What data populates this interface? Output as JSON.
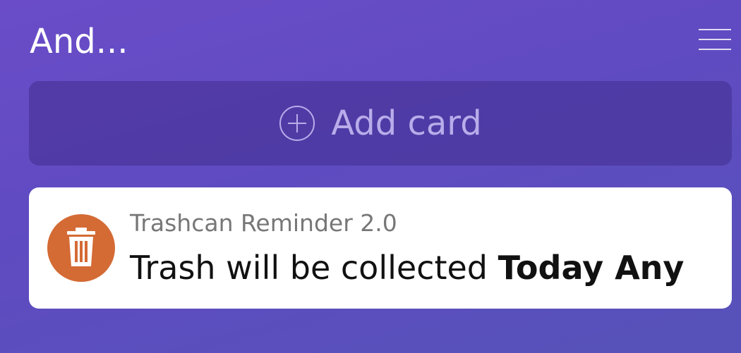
{
  "header": {
    "title": "And...",
    "menu_icon": "hamburger-menu-icon"
  },
  "add_card": {
    "icon": "plus-circle-icon",
    "label": "Add card"
  },
  "notification": {
    "icon": "trash-icon",
    "icon_bg_color": "#d46a34",
    "app_name": "Trashcan Reminder 2.0",
    "message_prefix": "Trash will be collected ",
    "message_emphasis": "Today Any"
  },
  "colors": {
    "background_top": "#6a4cc8",
    "background_bottom": "#5652b9",
    "card_bg": "#ffffff",
    "add_card_text": "#b9acea"
  }
}
